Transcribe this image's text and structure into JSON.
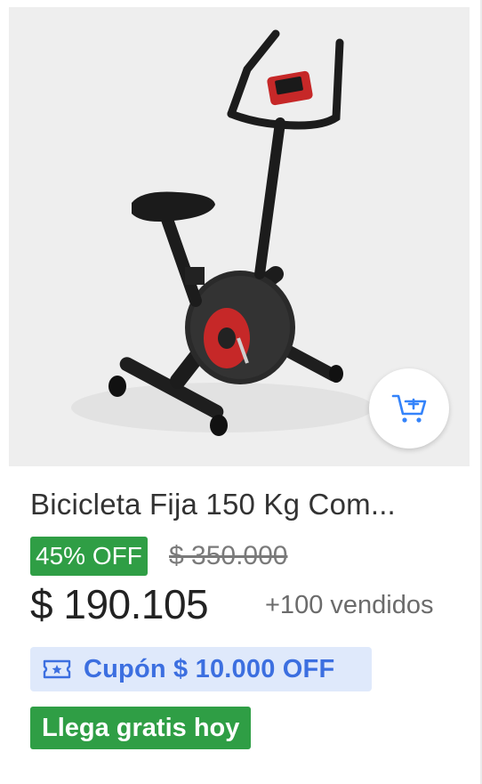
{
  "product": {
    "image_alt": "Exercise bike",
    "title": "Bicicleta Fija 150 Kg Com...",
    "discount": "45% OFF",
    "old_price": "$ 350.000",
    "price": "$ 190.105",
    "sold": "+100 vendidos",
    "coupon": "Cupón $ 10.000 OFF",
    "shipping": "Llega gratis hoy"
  },
  "icons": {
    "cart": "add-to-cart-icon",
    "coupon": "ticket-star-icon"
  },
  "colors": {
    "green_badge": "#2f9e45",
    "coupon_bg": "#dfe9fb",
    "coupon_text": "#3c6fe0",
    "accent_blue": "#3483fa"
  }
}
